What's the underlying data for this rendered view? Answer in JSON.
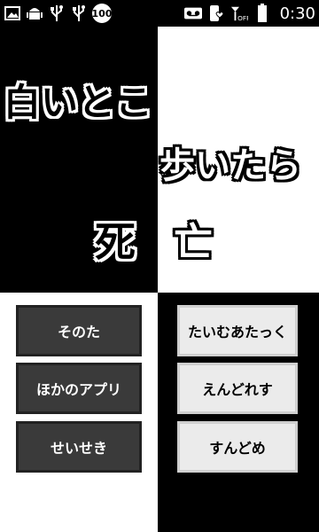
{
  "status_bar": {
    "badge": "100",
    "time": "0:30",
    "left_icons": [
      "image-icon",
      "android-icon",
      "usb-icon",
      "usb-icon",
      "notification-badge"
    ],
    "right_icons": [
      "voicemail-icon",
      "phone-heart-icon",
      "signal-off-icon",
      "battery-icon"
    ]
  },
  "game": {
    "line1": "白いとこ",
    "line2": "歩いたら",
    "line3_a": "死",
    "line3_b": "亡"
  },
  "menu": {
    "left": [
      "そのた",
      "ほかのアプリ",
      "せいせき"
    ],
    "right": [
      "たいむあたっく",
      "えんどれす",
      "すんどめ"
    ]
  }
}
